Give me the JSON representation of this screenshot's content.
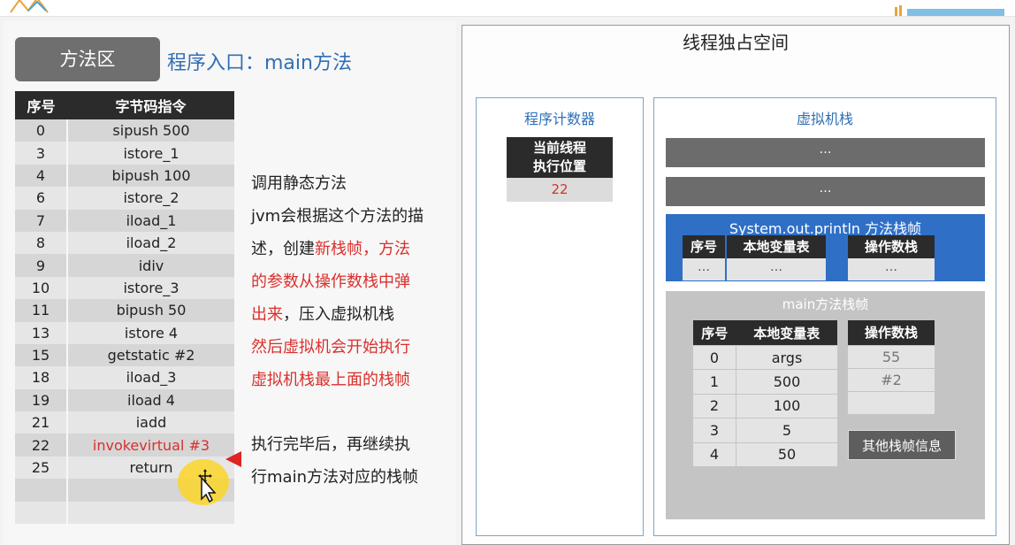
{
  "header": {
    "title": "方法区",
    "subtitle": "程序入口：main方法"
  },
  "bytecode_table": {
    "headers": [
      "序号",
      "字节码指令"
    ],
    "rows": [
      {
        "index": "0",
        "instruction": "sipush 500"
      },
      {
        "index": "3",
        "instruction": "istore_1"
      },
      {
        "index": "4",
        "instruction": "bipush 100"
      },
      {
        "index": "6",
        "instruction": "istore_2"
      },
      {
        "index": "7",
        "instruction": "iload_1"
      },
      {
        "index": "8",
        "instruction": "iload_2"
      },
      {
        "index": "9",
        "instruction": "idiv"
      },
      {
        "index": "10",
        "instruction": "istore_3"
      },
      {
        "index": "11",
        "instruction": "bipush 50"
      },
      {
        "index": "13",
        "instruction": "istore 4"
      },
      {
        "index": "15",
        "instruction": "getstatic #2"
      },
      {
        "index": "18",
        "instruction": "iload_3"
      },
      {
        "index": "19",
        "instruction": "iload 4"
      },
      {
        "index": "21",
        "instruction": "iadd"
      },
      {
        "index": "22",
        "instruction": "invokevirtual #3"
      },
      {
        "index": "25",
        "instruction": "return"
      },
      {
        "index": "",
        "instruction": ""
      },
      {
        "index": "",
        "instruction": ""
      }
    ],
    "highlight_color": "#d9302c"
  },
  "explanation": {
    "line1": "调用静态方法",
    "line2": "jvm会根据这个方法的描",
    "line3_a": "述，创建",
    "line3_b": "新栈帧，方法",
    "line4": "的参数从操作数栈中弹",
    "line5_a": "出来",
    "line5_b": "，压入虚拟机栈",
    "line6": "然后虚拟机会开始执行",
    "line7": "虚拟机栈最上面的栈帧",
    "after1": "执行完毕后，再继续执",
    "after2": "行main方法对应的栈帧"
  },
  "thread_space": {
    "title": "线程独占空间",
    "program_counter": {
      "title": "程序计数器",
      "head_line1": "当前线程",
      "head_line2": "执行位置",
      "value": "22"
    },
    "vm_stack": {
      "title": "虚拟机栈",
      "placeholder_frames": [
        "…",
        "…"
      ],
      "println_frame": {
        "title": "System.out.println 方法栈帧",
        "locals_headers": [
          "序号",
          "本地变量表"
        ],
        "locals_row": [
          "…",
          "…"
        ],
        "operand_header": "操作数栈",
        "operand_cell": "…"
      },
      "main_frame": {
        "title": "main方法栈帧",
        "locals_headers": [
          "序号",
          "本地变量表"
        ],
        "locals": [
          {
            "slot": "0",
            "value": "args"
          },
          {
            "slot": "1",
            "value": "500"
          },
          {
            "slot": "2",
            "value": "100"
          },
          {
            "slot": "3",
            "value": "5"
          },
          {
            "slot": "4",
            "value": "50"
          }
        ],
        "operand_header": "操作数栈",
        "operands": [
          "55",
          "#2",
          ""
        ],
        "other_info": "其他栈帧信息"
      }
    }
  },
  "colors": {
    "accent_blue": "#2f6fb5",
    "frame_blue": "#2f6fc6",
    "dark_header": "#2b2b2b",
    "alert_red": "#d9302c"
  }
}
